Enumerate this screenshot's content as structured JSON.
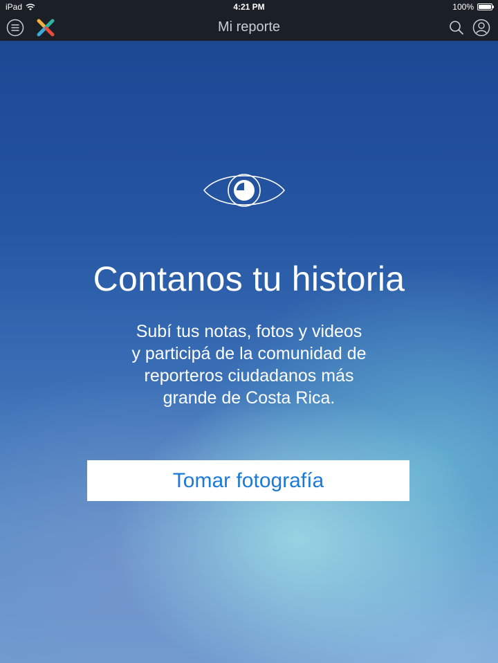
{
  "status_bar": {
    "device": "iPad",
    "time": "4:21 PM",
    "battery": "100%",
    "battery_level": 1.0
  },
  "nav": {
    "title": "Mi reporte",
    "icons": {
      "menu": "hamburger-menu-icon",
      "logo": "app-logo-icon",
      "search": "search-icon",
      "profile": "user-profile-icon"
    }
  },
  "hero": {
    "icon": "eye-icon",
    "headline": "Contanos tu historia",
    "description_lines": [
      "Subí tus notas, fotos y videos",
      "y participá de la comunidad de",
      "reporteros ciudadanos más",
      "grande de Costa Rica."
    ],
    "button_label": "Tomar fotografía"
  },
  "colors": {
    "nav_background": "#1b2026",
    "nav_title": "#c9ced3",
    "button_text": "#1b7ad8",
    "button_background": "#ffffff",
    "background_top": "#1c4793",
    "background_bottom": "#6f9dd0",
    "logo_colors": [
      "#e84c3d",
      "#f4b03e",
      "#2bb5a0",
      "#3aa8d8"
    ]
  }
}
